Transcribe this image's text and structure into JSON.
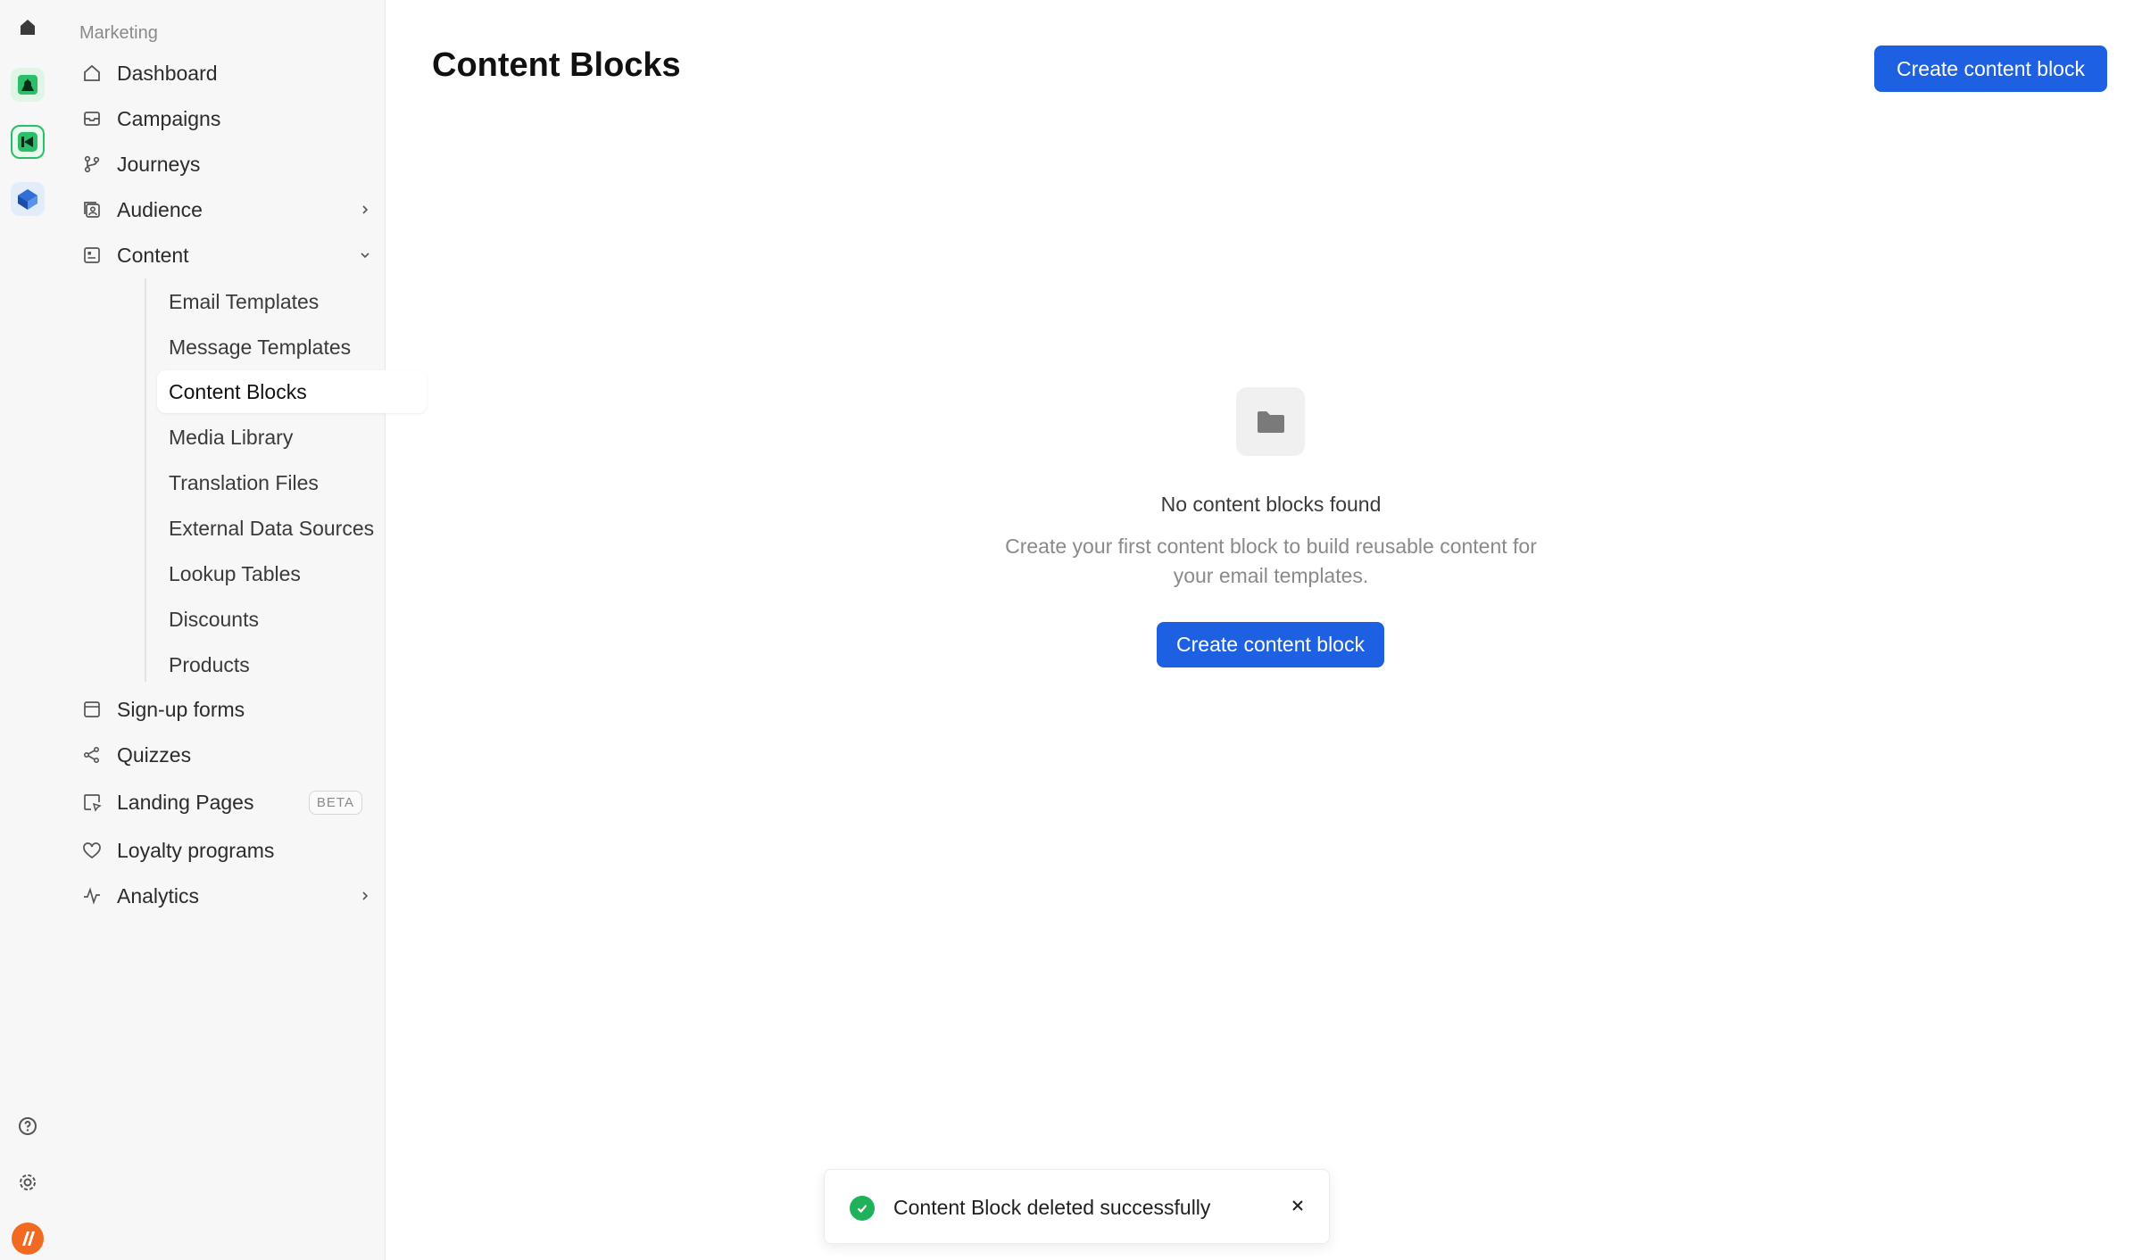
{
  "sidebar": {
    "section": "Marketing",
    "items": [
      {
        "label": "Dashboard",
        "icon": "home-icon"
      },
      {
        "label": "Campaigns",
        "icon": "inbox-icon"
      },
      {
        "label": "Journeys",
        "icon": "branch-icon"
      },
      {
        "label": "Audience",
        "icon": "audience-icon"
      },
      {
        "label": "Content",
        "icon": "content-icon"
      },
      {
        "label": "Sign-up forms",
        "icon": "form-icon"
      },
      {
        "label": "Quizzes",
        "icon": "quiz-icon"
      },
      {
        "label": "Landing Pages",
        "icon": "landing-icon",
        "badge": "BETA"
      },
      {
        "label": "Loyalty programs",
        "icon": "heart-icon"
      },
      {
        "label": "Analytics",
        "icon": "activity-icon"
      }
    ],
    "content_sub": [
      "Email Templates",
      "Message Templates",
      "Content Blocks",
      "Media Library",
      "Translation Files",
      "External Data Sources",
      "Lookup Tables",
      "Discounts",
      "Products"
    ]
  },
  "main": {
    "title": "Content Blocks",
    "create_button": "Create content block",
    "empty": {
      "title": "No content blocks found",
      "description": "Create your first content block to build reusable content for your email templates.",
      "button": "Create content block"
    }
  },
  "toast": {
    "message": "Content Block deleted successfully"
  },
  "colors": {
    "primary": "#1d61e2",
    "success": "#1fb25a",
    "sidebar_bg": "#f7f7f7"
  }
}
